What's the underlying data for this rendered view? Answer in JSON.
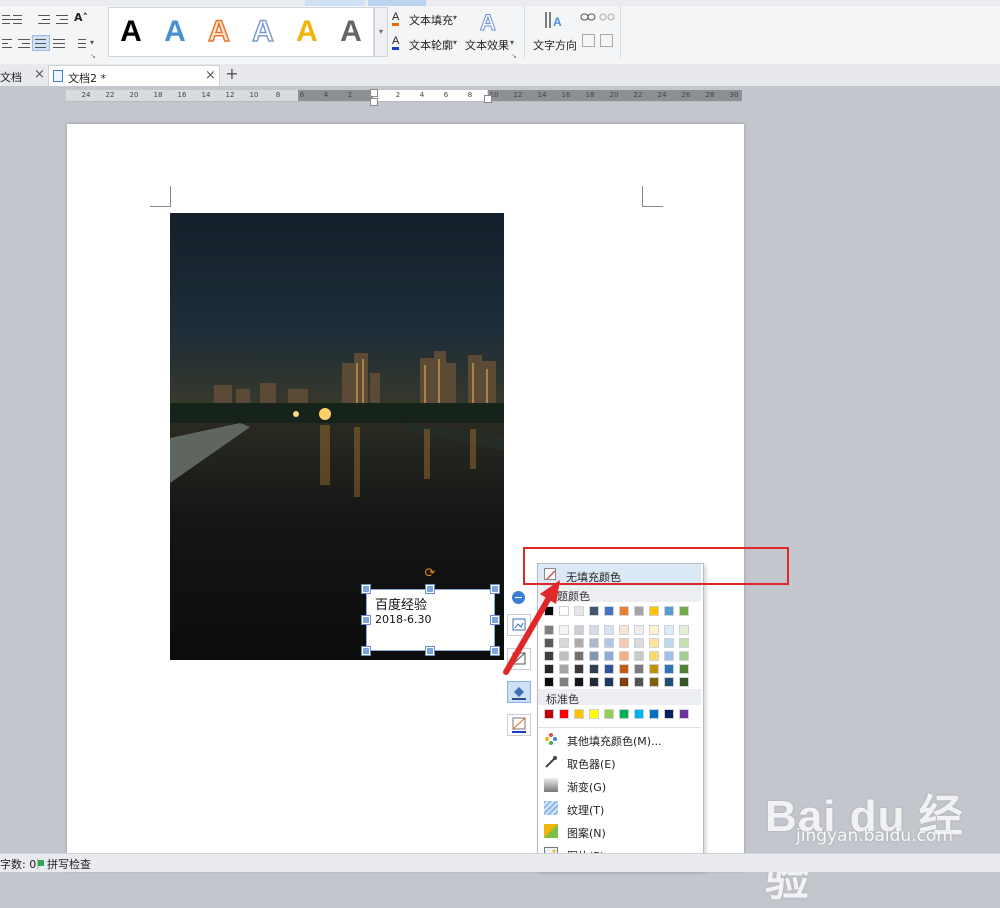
{
  "ribbon": {
    "text_fill_label": "文本填充",
    "text_outline_label": "文本轮廓",
    "text_effect_label": "文本效果",
    "text_direction_label": "文字方向",
    "style_letter": "A",
    "style_colors": [
      "#000000",
      "#4a8fd6",
      "#e8742c",
      "#ffffff",
      "#f2b50c",
      "#555555"
    ],
    "font_size_glyph": "A˄",
    "gallery_scroll_glyph": "▾",
    "dropdown_glyph": "▾",
    "group_corner_glyph": "↘"
  },
  "doc_tabs": {
    "tabs": [
      {
        "label": "文档",
        "active": false
      },
      {
        "label": "文档2 *",
        "active": true
      }
    ],
    "close_glyph": "×",
    "add_glyph": "+"
  },
  "ruler": {
    "ticks": [
      "24",
      "22",
      "20",
      "18",
      "16",
      "14",
      "12",
      "10",
      "8",
      "6",
      "4",
      "2",
      "2",
      "4",
      "6",
      "8",
      "10",
      "12",
      "14",
      "16",
      "18",
      "20",
      "22",
      "24",
      "26",
      "28",
      "30"
    ]
  },
  "textbox": {
    "line1": "百度经验",
    "line2": "2018-6.30",
    "rotate_glyph": "⟳"
  },
  "fill_popup": {
    "no_fill_label": "无填充颜色",
    "theme_colors_label": "主题颜色",
    "theme_top_row": [
      "#000000",
      "#ffffff",
      "#e7e6e6",
      "#44546a",
      "#4472c4",
      "#ed7d31",
      "#a5a5a5",
      "#ffc000",
      "#5b9bd5",
      "#70ad47"
    ],
    "theme_columns": [
      [
        "#7f7f7f",
        "#595959",
        "#3f3f3f",
        "#262626",
        "#0c0c0c"
      ],
      [
        "#f2f2f2",
        "#d8d8d8",
        "#bfbfbf",
        "#a5a5a5",
        "#7f7f7f"
      ],
      [
        "#d0cece",
        "#aeabab",
        "#757070",
        "#3a3838",
        "#161616"
      ],
      [
        "#d6dce4",
        "#adb9ca",
        "#8497b0",
        "#333f4f",
        "#222a35"
      ],
      [
        "#d9e2f3",
        "#b4c6e7",
        "#8eaadb",
        "#2f5496",
        "#1f3864"
      ],
      [
        "#fbe5d5",
        "#f7caac",
        "#f4b183",
        "#c55a11",
        "#833c0b"
      ],
      [
        "#ededed",
        "#dbdbdb",
        "#c9c9c9",
        "#7b7b7b",
        "#525252"
      ],
      [
        "#fff2cc",
        "#fee599",
        "#ffd965",
        "#bf9000",
        "#7f6000"
      ],
      [
        "#deebf6",
        "#bdd7ee",
        "#9cc3e5",
        "#2e75b5",
        "#1f4e79"
      ],
      [
        "#e2efd9",
        "#c5e0b3",
        "#a8d08d",
        "#538135",
        "#375623"
      ]
    ],
    "standard_colors_label": "标准色",
    "standard_colors": [
      "#c00000",
      "#ff0000",
      "#ffc000",
      "#ffff00",
      "#92d050",
      "#00b050",
      "#00b0f0",
      "#0070c0",
      "#002060",
      "#7030a0"
    ],
    "menu": [
      {
        "label": "其他填充颜色(M)...",
        "icon": "color-wheel-icon"
      },
      {
        "label": "取色器(E)",
        "icon": "eyedropper-icon"
      },
      {
        "label": "渐变(G)",
        "icon": "gradient-icon"
      },
      {
        "label": "纹理(T)",
        "icon": "texture-icon"
      },
      {
        "label": "图案(N)",
        "icon": "pattern-icon"
      },
      {
        "label": "图片(P)",
        "icon": "picture-icon"
      }
    ]
  },
  "status": {
    "word_count": "字数: 0",
    "spell_check": "拼写检查"
  },
  "watermark": {
    "logo": "Bai du 经验",
    "url": "jingyan.baidu.com"
  }
}
